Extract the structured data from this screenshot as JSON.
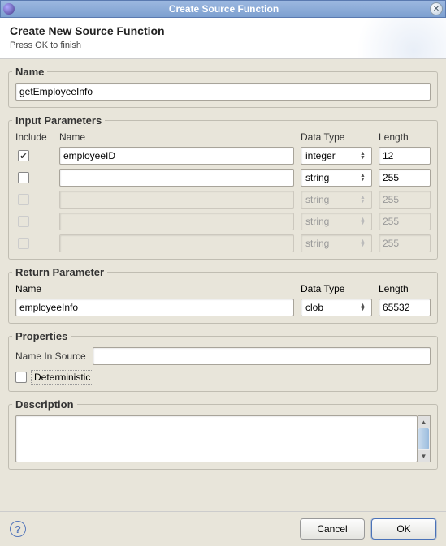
{
  "window": {
    "title": "Create Source Function"
  },
  "header": {
    "title": "Create New Source Function",
    "subtitle": "Press OK to finish"
  },
  "sections": {
    "name": {
      "legend": "Name",
      "value": "getEmployeeInfo"
    },
    "input_params": {
      "legend": "Input Parameters",
      "columns": {
        "include": "Include",
        "name": "Name",
        "datatype": "Data Type",
        "length": "Length"
      },
      "rows": [
        {
          "include": true,
          "name": "employeeID",
          "datatype": "integer",
          "length": "12",
          "enabled": true
        },
        {
          "include": false,
          "name": "",
          "datatype": "string",
          "length": "255",
          "enabled": true
        },
        {
          "include": false,
          "name": "",
          "datatype": "string",
          "length": "255",
          "enabled": false
        },
        {
          "include": false,
          "name": "",
          "datatype": "string",
          "length": "255",
          "enabled": false
        },
        {
          "include": false,
          "name": "",
          "datatype": "string",
          "length": "255",
          "enabled": false
        }
      ]
    },
    "return_param": {
      "legend": "Return Parameter",
      "columns": {
        "name": "Name",
        "datatype": "Data Type",
        "length": "Length"
      },
      "name": "employeeInfo",
      "datatype": "clob",
      "length": "65532"
    },
    "properties": {
      "legend": "Properties",
      "name_in_source_label": "Name In Source",
      "name_in_source_value": "",
      "deterministic_label": "Deterministic",
      "deterministic_checked": false
    },
    "description": {
      "legend": "Description",
      "value": ""
    }
  },
  "buttons": {
    "help": "?",
    "cancel": "Cancel",
    "ok": "OK"
  }
}
